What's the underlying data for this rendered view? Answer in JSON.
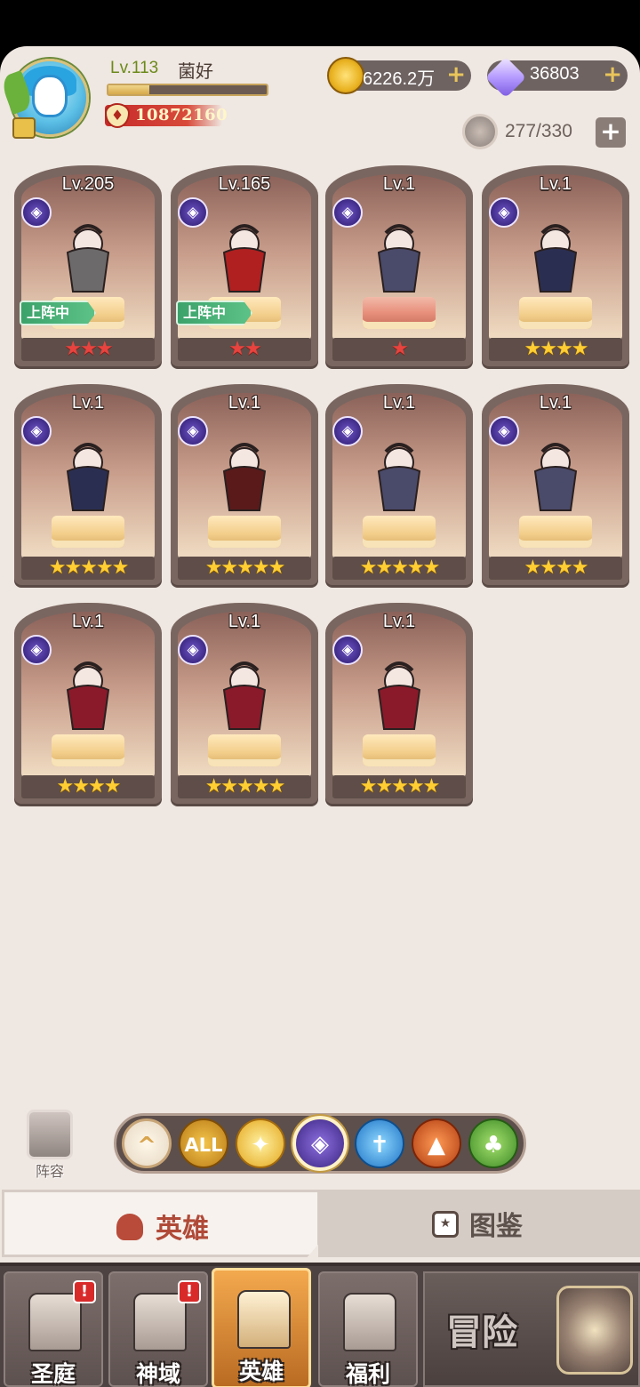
{
  "player": {
    "level": "Lv.113",
    "name": "菌好",
    "exp_progress": 0.26,
    "power": "10872160"
  },
  "resources": {
    "gold": "6226.2万",
    "gems": "36803",
    "plus": "+"
  },
  "hero_capacity": {
    "value": "277/330",
    "plus": "+"
  },
  "heroes": [
    {
      "level": "Lv.205",
      "stars": "★★★",
      "star_color": "red",
      "deployed": "上阵中"
    },
    {
      "level": "Lv.165",
      "stars": "★★",
      "star_color": "red",
      "deployed": "上阵中"
    },
    {
      "level": "Lv.1",
      "stars": "★",
      "star_color": "red",
      "deployed": ""
    },
    {
      "level": "Lv.1",
      "stars": "★★★★",
      "star_color": "gold",
      "deployed": ""
    },
    {
      "level": "Lv.1",
      "stars": "★★★★★",
      "star_color": "gold",
      "deployed": ""
    },
    {
      "level": "Lv.1",
      "stars": "★★★★★",
      "star_color": "gold",
      "deployed": ""
    },
    {
      "level": "Lv.1",
      "stars": "★★★★★",
      "star_color": "gold",
      "deployed": ""
    },
    {
      "level": "Lv.1",
      "stars": "★★★★",
      "star_color": "gold",
      "deployed": ""
    },
    {
      "level": "Lv.1",
      "stars": "★★★★",
      "star_color": "gold",
      "deployed": ""
    },
    {
      "level": "Lv.1",
      "stars": "★★★★★",
      "star_color": "gold",
      "deployed": ""
    },
    {
      "level": "Lv.1",
      "stars": "★★★★★",
      "star_color": "gold",
      "deployed": ""
    }
  ],
  "faction_icon": "dark-faction-icon",
  "lineup": {
    "label": "阵容"
  },
  "filters": [
    {
      "label": "^",
      "icon": "sort-up-icon"
    },
    {
      "label": "ALL",
      "icon": "all-factions-icon"
    },
    {
      "label": "✦",
      "icon": "light-faction-icon"
    },
    {
      "label": "◈",
      "icon": "dark-faction-icon"
    },
    {
      "label": "✝",
      "icon": "holy-faction-icon"
    },
    {
      "label": "▲",
      "icon": "beast-faction-icon"
    },
    {
      "label": "♣",
      "icon": "nature-faction-icon"
    }
  ],
  "tabs": {
    "heroes": "英雄",
    "gallery": "图鉴"
  },
  "nav": {
    "court": "圣庭",
    "divine": "神域",
    "heroes": "英雄",
    "welfare": "福利",
    "adventure": "冒险",
    "alert": "!"
  }
}
